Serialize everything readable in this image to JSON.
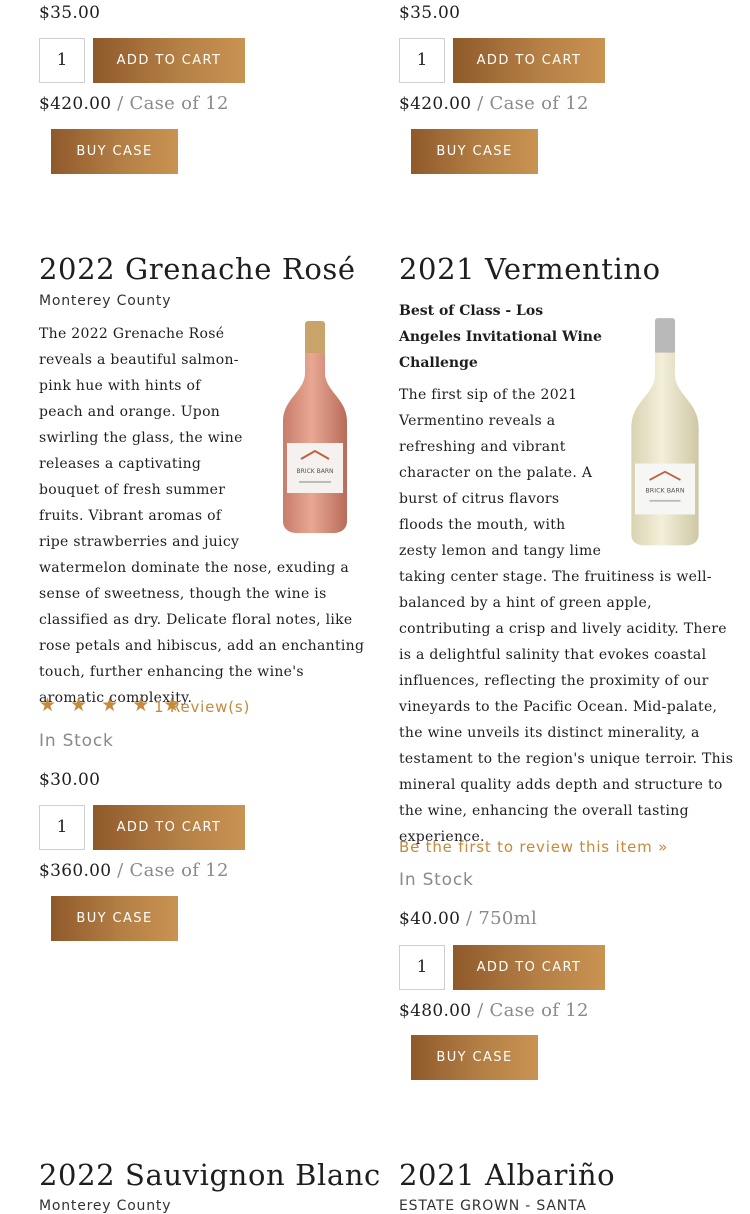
{
  "top_left": {
    "price": "$35.00",
    "qty": "1",
    "add_to_cart": "ADD TO CART",
    "case_price": "$420.00",
    "case_label": "/ Case of 12",
    "buy_case": "BUY CASE"
  },
  "top_right": {
    "price": "$35.00",
    "qty": "1",
    "add_to_cart": "ADD TO CART",
    "case_price": "$420.00",
    "case_label": "/ Case of 12",
    "buy_case": "BUY CASE"
  },
  "grenache": {
    "title": "2022 Grenache Rosé",
    "subtitle": "Monterey County",
    "bottle_label": "BRICK BARN",
    "description": "The 2022 Grenache Rosé reveals a beautiful salmon-pink hue with hints of peach and orange. Upon swirling the glass, the wine releases a captivating bouquet of fresh summer fruits. Vibrant aromas of ripe strawberries and juicy watermelon dominate the nose, exuding a sense of sweetness, though the wine is classified as dry. Delicate floral notes, like rose petals and hibiscus, add an enchanting touch, further enhancing the wine's aromatic complexity.",
    "stars": "★ ★ ★ ★ ★",
    "rating": 5,
    "reviews": "1 Review(s)",
    "stock": "In Stock",
    "price": "$30.00",
    "qty": "1",
    "add_to_cart": "ADD TO CART",
    "case_price": "$360.00",
    "case_label": "/ Case of 12",
    "buy_case": "BUY CASE"
  },
  "vermentino": {
    "title": "2021 Vermentino",
    "award": "Best of Class - Los Angeles Invitational Wine Challenge",
    "bottle_label": "BRICK BARN",
    "description": "The first sip of the 2021 Vermentino reveals a refreshing and vibrant character on the palate. A burst of citrus flavors floods the mouth, with zesty lemon and tangy lime taking center stage. The fruitiness is well-balanced by a hint of green apple, contributing a crisp and lively acidity. There is a delightful salinity that evokes coastal influences, reflecting the proximity of our vineyards to the Pacific Ocean. Mid-palate, the wine unveils its distinct minerality, a testament to the region's unique terroir. This mineral quality adds depth and structure to the wine, enhancing the overall tasting experience.",
    "review_link": "Be the first to review this item »",
    "stock": "In Stock",
    "price": "$40.00",
    "price_unit": "/ 750ml",
    "qty": "1",
    "add_to_cart": "ADD TO CART",
    "case_price": "$480.00",
    "case_label": "/ Case of 12",
    "buy_case": "BUY CASE"
  },
  "sauvignon": {
    "title": "2022 Sauvignon Blanc",
    "subtitle": "Monterey County"
  },
  "albarino": {
    "title": "2021 Albariño",
    "subtitle": "ESTATE GROWN - SANTA"
  },
  "colors": {
    "accent_gold": "#c68a3a",
    "button_dark": "#8f5a2a",
    "button_light": "#c99352",
    "muted_text": "#8a8a8a"
  }
}
